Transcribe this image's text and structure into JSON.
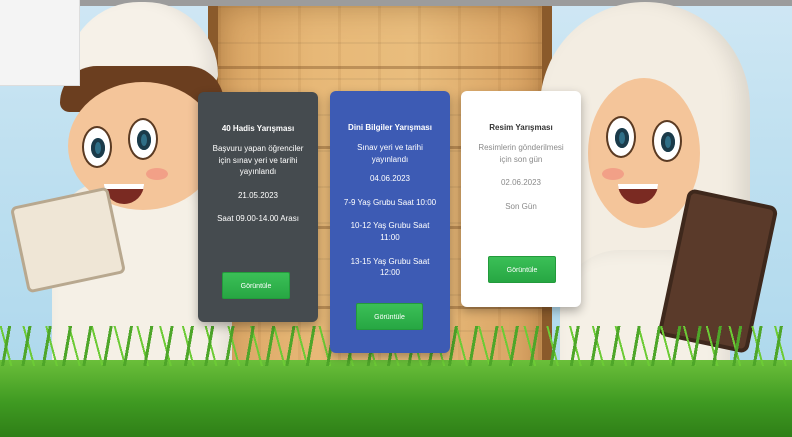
{
  "cards": [
    {
      "title": "40 Hadis Yarışması",
      "lines": [
        "Başvuru yapan öğrenciler",
        "için sınav yeri ve tarihi",
        "yayınlandı",
        "21.05.2023",
        "Saat 09.00-14.00 Arası"
      ],
      "button": "Görüntüle",
      "color": "#454b4f"
    },
    {
      "title": "Dini Bilgiler Yarışması",
      "lines": [
        "Sınav yeri ve tarihi",
        "yayınlandı",
        "04.06.2023",
        "7-9 Yaş Grubu Saat 10:00",
        "10-12 Yaş Grubu Saat 11:00",
        "13-15 Yaş Grubu Saat 12:00"
      ],
      "button": "Görüntüle",
      "color": "#3d5bb4"
    },
    {
      "title": "Resim Yarışması",
      "lines": [
        "Resimlerin gönderilmesi",
        "için son gün",
        "02.06.2023",
        "Son Gün"
      ],
      "button": "Görüntüle",
      "color": "#ffffff"
    }
  ],
  "colors": {
    "accent_button": "#27a743",
    "board_wood": "#e7b877",
    "sky": "#bfe0f0",
    "grass": "#3f9a22"
  }
}
